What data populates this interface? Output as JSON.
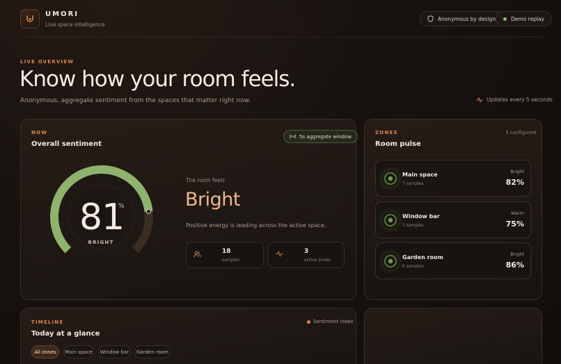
{
  "brand": {
    "name": "UMORI",
    "tagline": "Live space intelligence"
  },
  "header": {
    "anonymous_label": "Anonymous by design",
    "demo_label": "Demo replay"
  },
  "hero": {
    "eyebrow": "LIVE OVERVIEW",
    "title": "Know how your room feels.",
    "subtitle": "Anonymous, aggregate sentiment from the spaces that matter right now.",
    "updates": "Updates every 5 seconds"
  },
  "sentiment": {
    "eyebrow": "NOW",
    "title": "Overall sentiment",
    "window_label": "5s aggregate window",
    "score": "81",
    "score_value": 81,
    "unit": "%",
    "score_label": "BRIGHT",
    "feels_label": "The room feels",
    "feels_value": "Bright",
    "description": "Positive energy is leading across the active space.",
    "stats": [
      {
        "value": "18",
        "label": "samples",
        "icon": "people-icon"
      },
      {
        "value": "3",
        "label": "active zones",
        "icon": "pulse-icon"
      }
    ]
  },
  "zones": {
    "eyebrow": "ZONES",
    "title": "Room pulse",
    "count": "3 configured",
    "items": [
      {
        "name": "Main space",
        "samples": "7 samples",
        "mood": "Bright",
        "pct": "82%"
      },
      {
        "name": "Window bar",
        "samples": "5 samples",
        "mood": "Warm",
        "pct": "75%"
      },
      {
        "name": "Garden room",
        "samples": "6 samples",
        "mood": "Bright",
        "pct": "86%"
      }
    ]
  },
  "timeline": {
    "eyebrow": "TIMELINE",
    "title": "Today at a glance",
    "legend": "Sentiment index",
    "filters": [
      "All zones",
      "Main space",
      "Window bar",
      "Garden room"
    ],
    "active_filter": "All zones"
  },
  "colors": {
    "accent": "#e0864a",
    "positive": "#8fbf6a",
    "headline": "#f0b98c"
  }
}
